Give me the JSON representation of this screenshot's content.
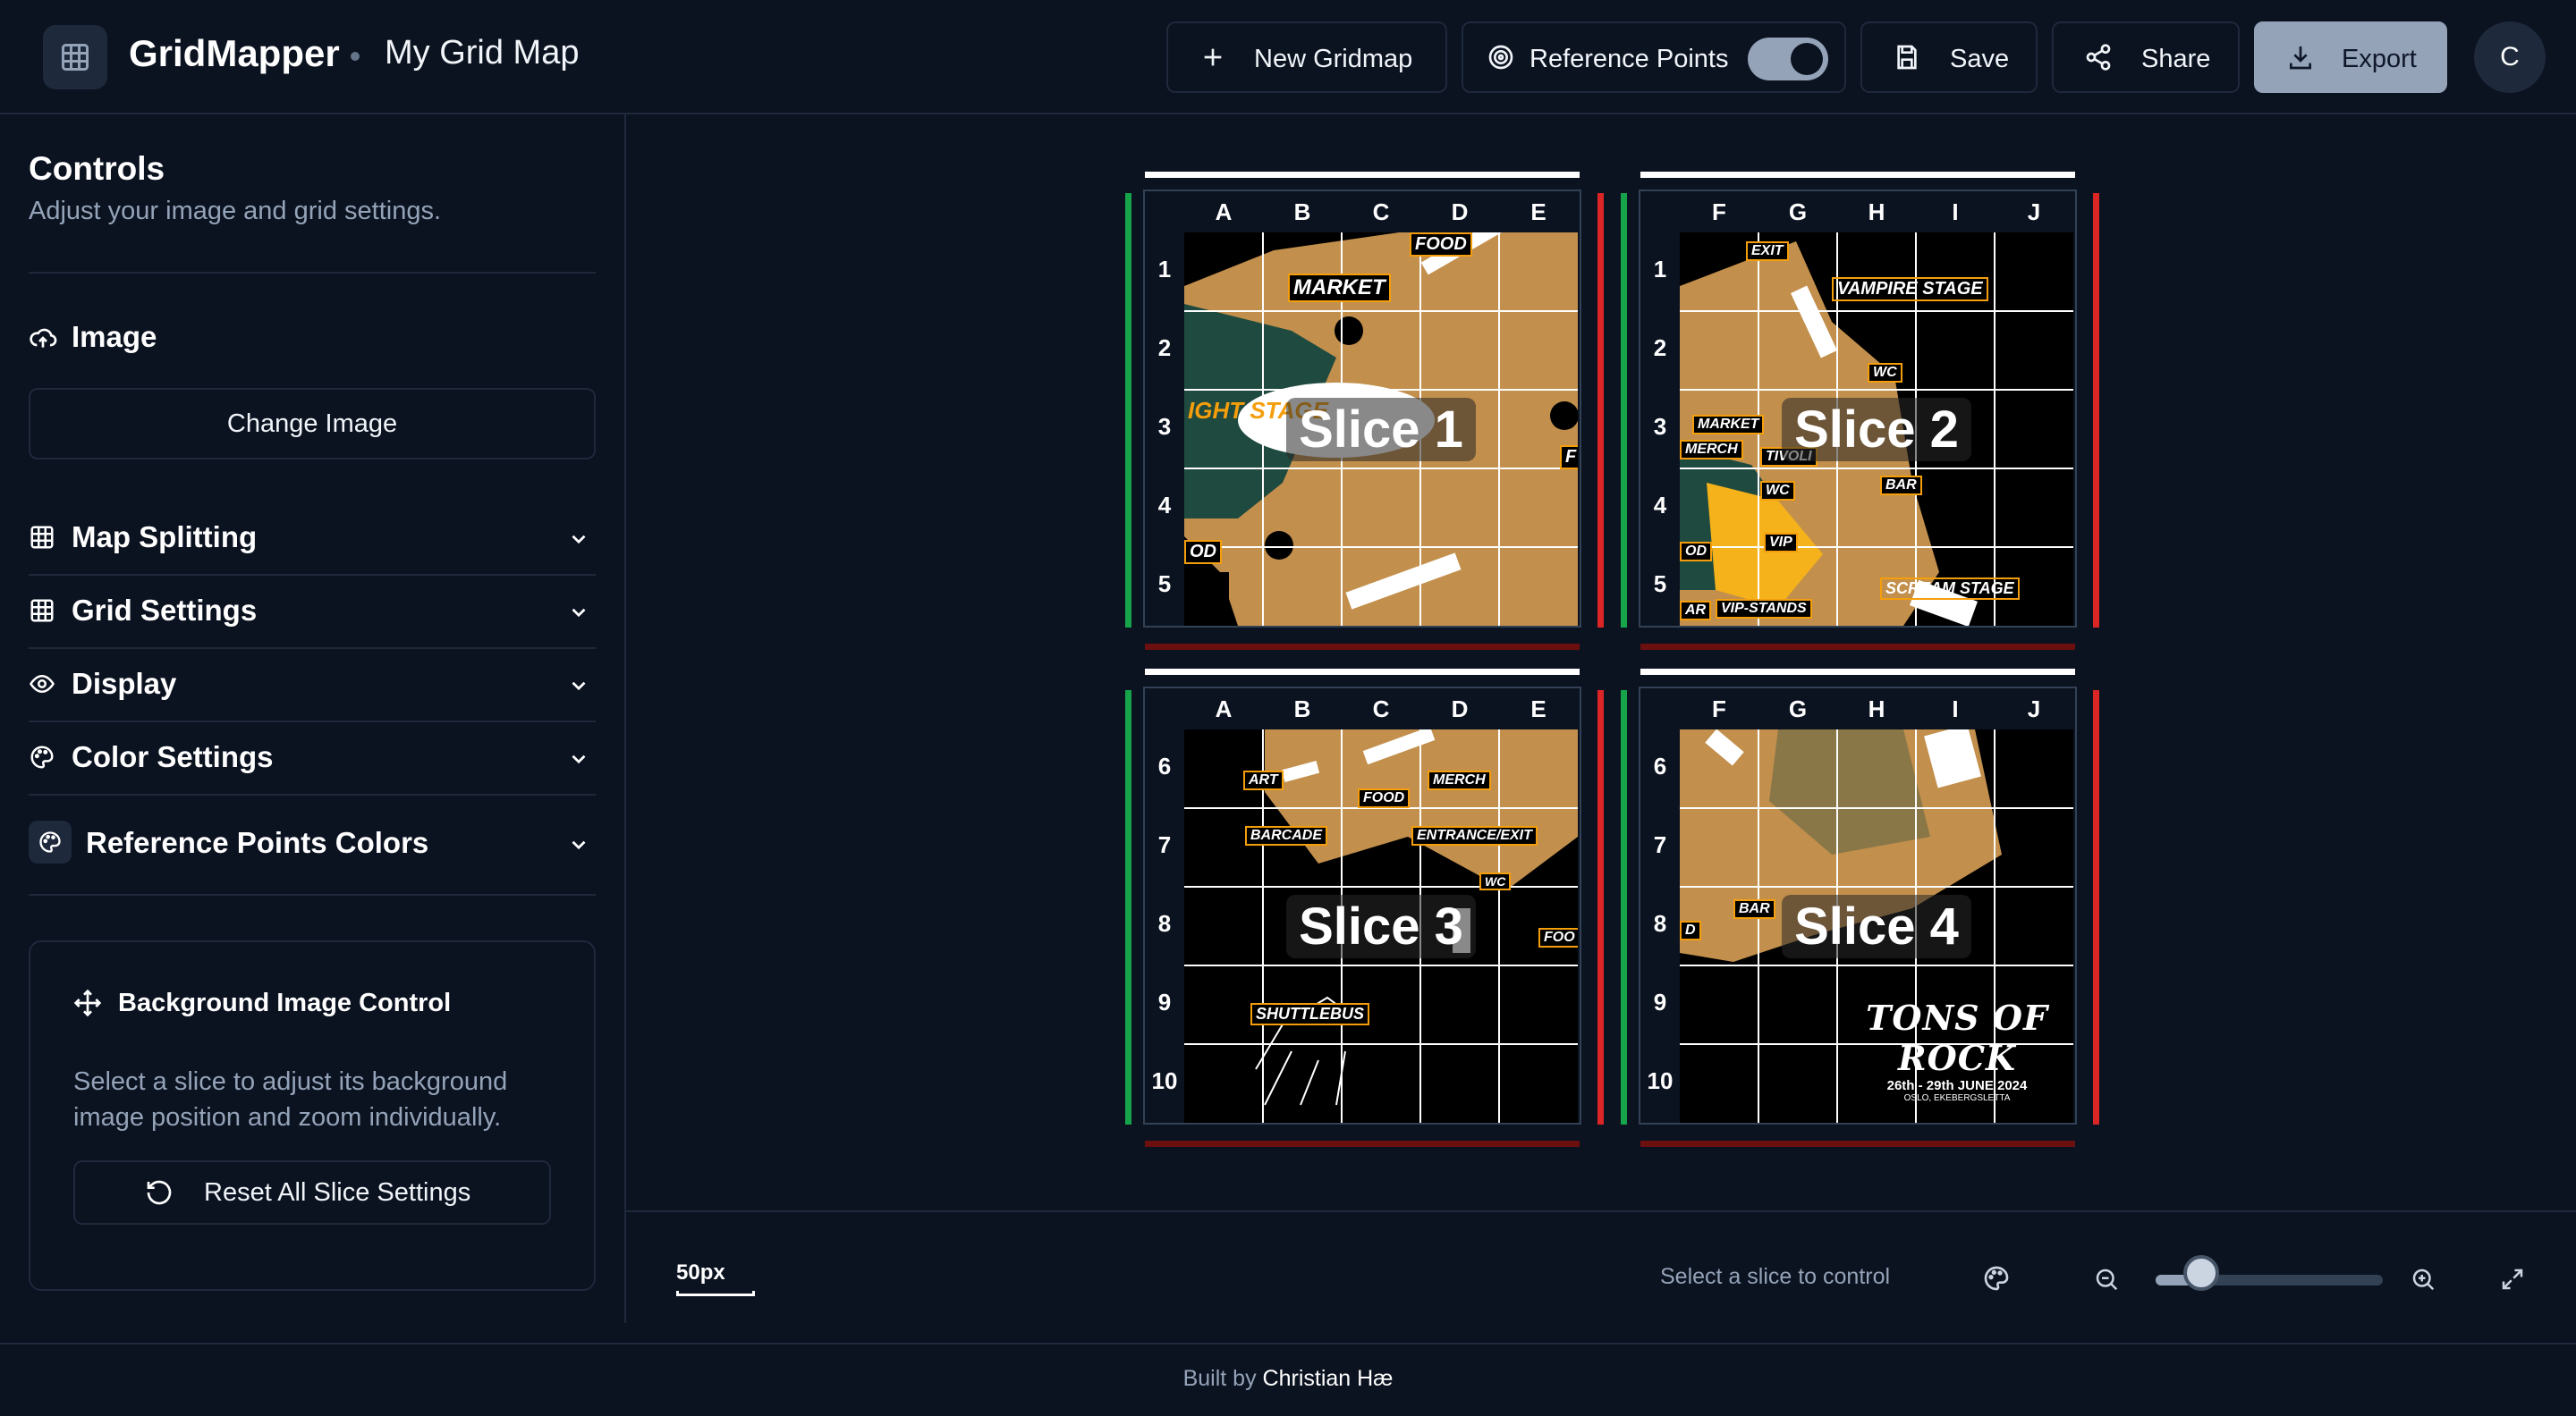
{
  "header": {
    "app_name": "GridMapper",
    "map_name": "My Grid Map",
    "new_gridmap": "New Gridmap",
    "reference_points": "Reference Points",
    "reference_points_on": true,
    "save": "Save",
    "share": "Share",
    "export": "Export",
    "avatar_initial": "C"
  },
  "sidebar": {
    "title": "Controls",
    "subtitle": "Adjust your image and grid settings.",
    "image_section": "Image",
    "change_image": "Change Image",
    "sections": [
      "Map Splitting",
      "Grid Settings",
      "Display",
      "Color Settings",
      "Reference Points Colors"
    ],
    "bg_control": {
      "title": "Background Image Control",
      "description": "Select a slice to adjust its background image position and zoom individually.",
      "reset_button": "Reset All Slice Settings"
    }
  },
  "slices": [
    {
      "label": "Slice 1",
      "columns": [
        "A",
        "B",
        "C",
        "D",
        "E"
      ],
      "rows": [
        "1",
        "2",
        "3",
        "4",
        "5"
      ],
      "tags": [
        "FOOD",
        "MARKET",
        "IGHT STAGE",
        "F",
        "OD"
      ]
    },
    {
      "label": "Slice 2",
      "columns": [
        "F",
        "G",
        "H",
        "I",
        "J"
      ],
      "rows": [
        "1",
        "2",
        "3",
        "4",
        "5"
      ],
      "tags": [
        "EXIT",
        "VAMPIRE STAGE",
        "WC",
        "MARKET",
        "MERCH",
        "TIVOLI",
        "WC",
        "BAR",
        "VIP",
        "OD",
        "SCREAM STAGE",
        "AR",
        "VIP-STANDS"
      ]
    },
    {
      "label": "Slice 3",
      "columns": [
        "A",
        "B",
        "C",
        "D",
        "E"
      ],
      "rows": [
        "6",
        "7",
        "8",
        "9",
        "10"
      ],
      "tags": [
        "ART",
        "FOOD",
        "MERCH",
        "BARCADE",
        "ENTRANCE/EXIT",
        "WC",
        "FOO",
        "SHUTTLEBUS"
      ]
    },
    {
      "label": "Slice 4",
      "columns": [
        "F",
        "G",
        "H",
        "I",
        "J"
      ],
      "rows": [
        "6",
        "7",
        "8",
        "9",
        "10"
      ],
      "tags": [
        "BAR",
        "D"
      ],
      "logo_text": "TONS OF ROCK",
      "logo_date": "26th - 29th JUNE 2024",
      "logo_place": "OSLO, EKEBERGSLETTA"
    }
  ],
  "bottom": {
    "scale": "50px",
    "status": "Select a slice to control",
    "zoom_level": 0.2
  },
  "footer": {
    "prefix": "Built by",
    "author": "Christian Hæ"
  },
  "colors": {
    "background": "#0b1220",
    "map_tan": "#c28f4c",
    "map_green": "#1f4a3f",
    "reference_green": "#16a34a",
    "reference_red": "#dc2626",
    "accent_yellow": "#f59e0b"
  }
}
